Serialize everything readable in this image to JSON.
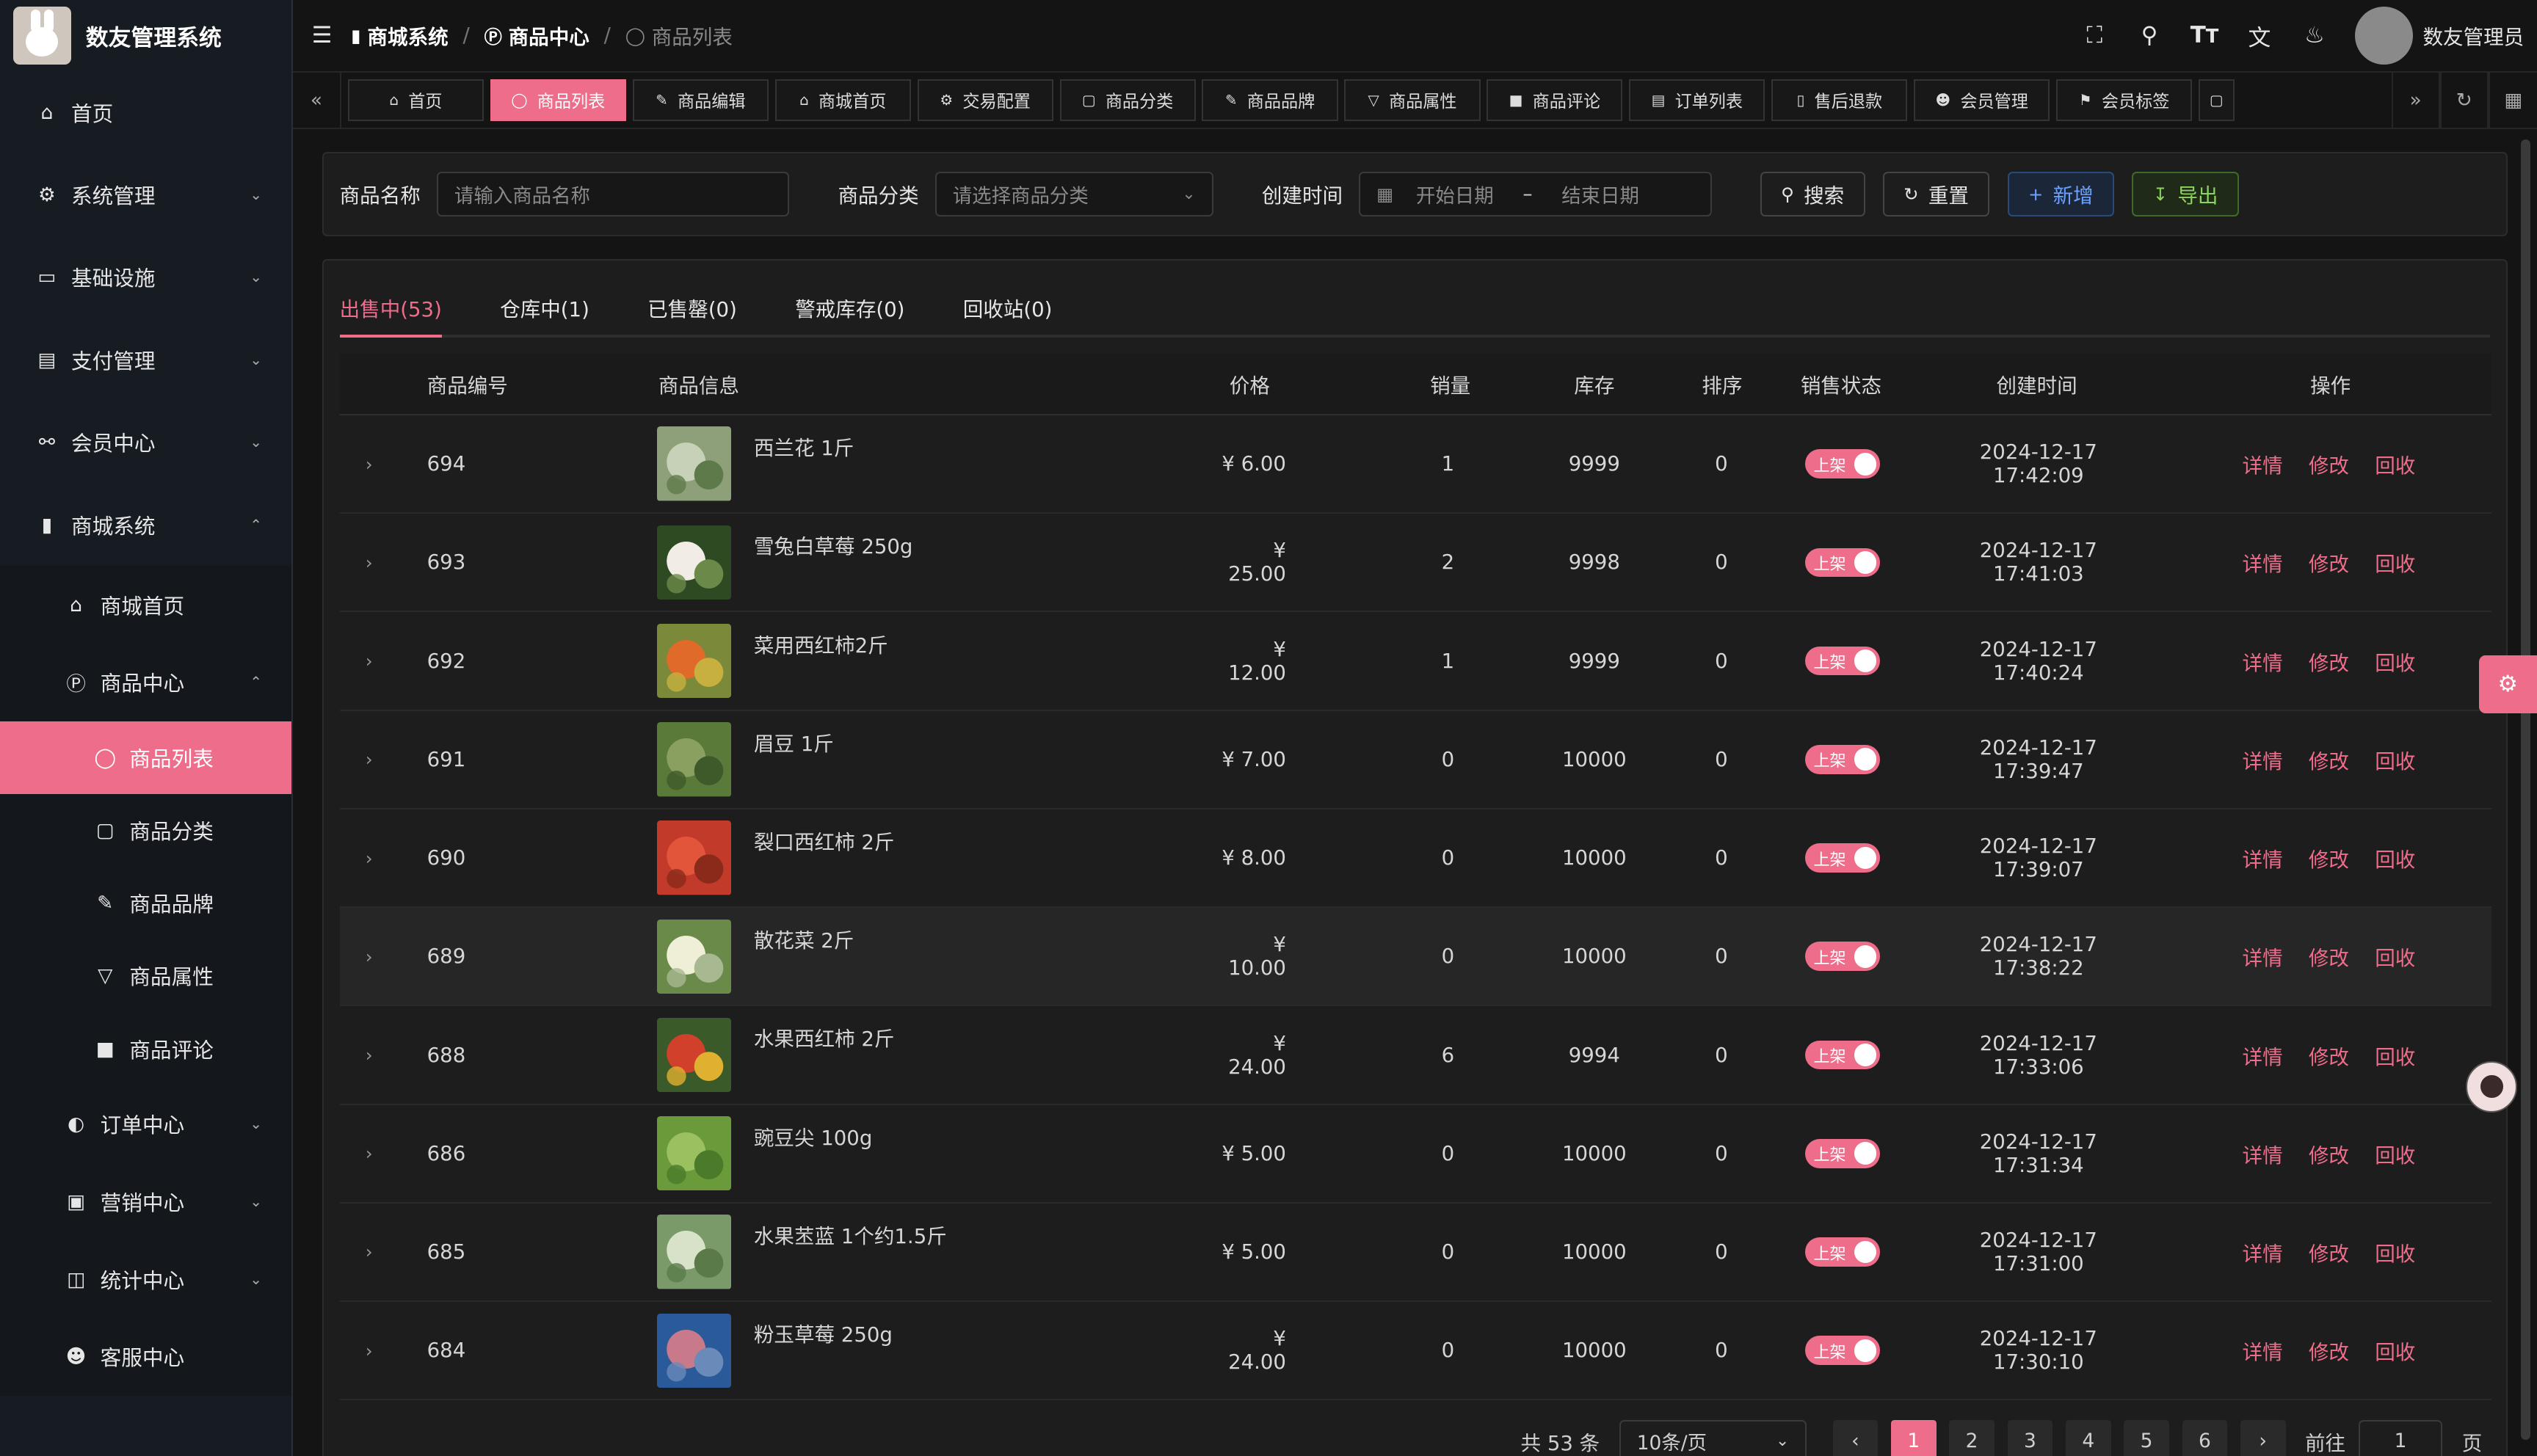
{
  "app": {
    "title": "数友管理系统",
    "user_name": "数友管理员",
    "accent": "#ed6d8a"
  },
  "sidebar": {
    "items": [
      {
        "label": "首页",
        "icon": "home-icon"
      },
      {
        "label": "系统管理",
        "icon": "gear-icon"
      },
      {
        "label": "基础设施",
        "icon": "monitor-icon"
      },
      {
        "label": "支付管理",
        "icon": "wallet-icon"
      },
      {
        "label": "会员中心",
        "icon": "members-icon"
      },
      {
        "label": "商城系统",
        "icon": "shop-icon"
      }
    ],
    "shop_sub": [
      {
        "label": "商城首页",
        "icon": "home-icon"
      },
      {
        "label": "商品中心",
        "icon": "p-circle-icon"
      }
    ],
    "product_sub": [
      {
        "label": "商品列表",
        "icon": "apple-icon"
      },
      {
        "label": "商品分类",
        "icon": "document-icon"
      },
      {
        "label": "商品品牌",
        "icon": "brush-icon"
      },
      {
        "label": "商品属性",
        "icon": "filter-icon"
      },
      {
        "label": "商品评论",
        "icon": "comment-icon"
      }
    ],
    "shop_rest": [
      {
        "label": "订单中心",
        "icon": "order-icon"
      },
      {
        "label": "营销中心",
        "icon": "gift-icon"
      },
      {
        "label": "统计中心",
        "icon": "chart-icon"
      },
      {
        "label": "客服中心",
        "icon": "user-icon"
      }
    ]
  },
  "breadcrumb": [
    "商城系统",
    "商品中心",
    "商品列表"
  ],
  "tabs": [
    {
      "label": "首页",
      "icon": "home-icon"
    },
    {
      "label": "商品列表",
      "icon": "apple-icon"
    },
    {
      "label": "商品编辑",
      "icon": "edit-icon"
    },
    {
      "label": "商城首页",
      "icon": "home-icon"
    },
    {
      "label": "交易配置",
      "icon": "gear-icon"
    },
    {
      "label": "商品分类",
      "icon": "document-icon"
    },
    {
      "label": "商品品牌",
      "icon": "brush-icon"
    },
    {
      "label": "商品属性",
      "icon": "filter-icon"
    },
    {
      "label": "商品评论",
      "icon": "comment-icon"
    },
    {
      "label": "订单列表",
      "icon": "list-icon"
    },
    {
      "label": "售后退款",
      "icon": "refund-icon"
    },
    {
      "label": "会员管理",
      "icon": "user-icon"
    },
    {
      "label": "会员标签",
      "icon": "bookmark-icon"
    }
  ],
  "search": {
    "name_label": "商品名称",
    "name_placeholder": "请输入商品名称",
    "category_label": "商品分类",
    "category_placeholder": "请选择商品分类",
    "time_label": "创建时间",
    "start_placeholder": "开始日期",
    "range_sep": "–",
    "end_placeholder": "结束日期",
    "search_btn": "搜索",
    "reset_btn": "重置",
    "add_btn": "新增",
    "export_btn": "导出"
  },
  "status_tabs": [
    "出售中(53)",
    "仓库中(1)",
    "已售罄(0)",
    "警戒库存(0)",
    "回收站(0)"
  ],
  "table": {
    "headers": [
      "商品编号",
      "商品信息",
      "价格",
      "销量",
      "库存",
      "排序",
      "销售状态",
      "创建时间",
      "操作"
    ],
    "status_label": "上架",
    "ops": [
      "详情",
      "修改",
      "回收"
    ],
    "rows": [
      {
        "id": "694",
        "name": "西兰花 1斤",
        "price": "¥ 6.00",
        "sales": "1",
        "stock": "9999",
        "sort": "0",
        "time": "2024-12-17 17:42:09",
        "img": "broccoli"
      },
      {
        "id": "693",
        "name": "雪兔白草莓 250g",
        "price": "¥ 25.00",
        "sales": "2",
        "stock": "9998",
        "sort": "0",
        "time": "2024-12-17 17:41:03",
        "img": "strawberry-white"
      },
      {
        "id": "692",
        "name": "菜用西红柿2斤",
        "price": "¥ 12.00",
        "sales": "1",
        "stock": "9999",
        "sort": "0",
        "time": "2024-12-17 17:40:24",
        "img": "tomato"
      },
      {
        "id": "691",
        "name": "眉豆 1斤",
        "price": "¥ 7.00",
        "sales": "0",
        "stock": "10000",
        "sort": "0",
        "time": "2024-12-17 17:39:47",
        "img": "beans"
      },
      {
        "id": "690",
        "name": "裂口西红柿 2斤",
        "price": "¥ 8.00",
        "sales": "0",
        "stock": "10000",
        "sort": "0",
        "time": "2024-12-17 17:39:07",
        "img": "tomato-red"
      },
      {
        "id": "689",
        "name": "散花菜 2斤",
        "price": "¥ 10.00",
        "sales": "0",
        "stock": "10000",
        "sort": "0",
        "time": "2024-12-17 17:38:22",
        "img": "cauliflower"
      },
      {
        "id": "688",
        "name": "水果西红柿 2斤",
        "price": "¥ 24.00",
        "sales": "6",
        "stock": "9994",
        "sort": "0",
        "time": "2024-12-17 17:33:06",
        "img": "tomato-mix"
      },
      {
        "id": "686",
        "name": "豌豆尖 100g",
        "price": "¥ 5.00",
        "sales": "0",
        "stock": "10000",
        "sort": "0",
        "time": "2024-12-17 17:31:34",
        "img": "pea-shoots"
      },
      {
        "id": "685",
        "name": "水果苤蓝 1个约1.5斤",
        "price": "¥ 5.00",
        "sales": "0",
        "stock": "10000",
        "sort": "0",
        "time": "2024-12-17 17:31:00",
        "img": "kohlrabi"
      },
      {
        "id": "684",
        "name": "粉玉草莓 250g",
        "price": "¥ 24.00",
        "sales": "0",
        "stock": "10000",
        "sort": "0",
        "time": "2024-12-17 17:30:10",
        "img": "strawberry-pink"
      }
    ]
  },
  "pager": {
    "total": "共 53 条",
    "page_size": "10条/页",
    "pages": [
      "1",
      "2",
      "3",
      "4",
      "5",
      "6"
    ],
    "current": "1",
    "goto_label": "前往",
    "goto_value": "1",
    "page_suffix": "页"
  }
}
